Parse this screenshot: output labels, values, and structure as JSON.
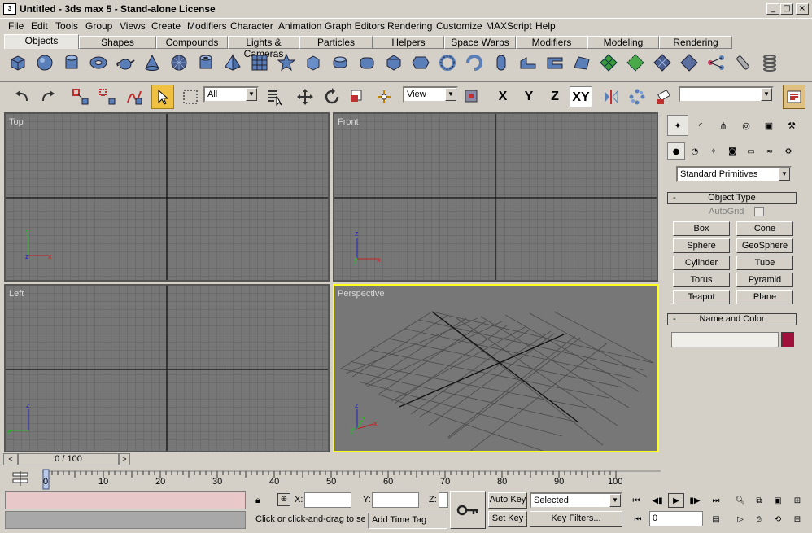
{
  "window": {
    "title": "Untitled - 3ds max 5 - Stand-alone License",
    "app_icon": "3ds-max-icon"
  },
  "menu": [
    "File",
    "Edit",
    "Tools",
    "Group",
    "Views",
    "Create",
    "Modifiers",
    "Character",
    "Animation",
    "Graph Editors",
    "Rendering",
    "Customize",
    "MAXScript",
    "Help"
  ],
  "tabs": [
    "Objects",
    "Shapes",
    "Compounds",
    "Lights & Cameras",
    "Particles",
    "Helpers",
    "Space Warps",
    "Modifiers",
    "Modeling",
    "Rendering"
  ],
  "active_tab": "Objects",
  "toolbar": {
    "selection_filter": "All",
    "reference_coord": "View",
    "axis_x": "X",
    "axis_y": "Y",
    "axis_z": "Z",
    "axis_xy": "XY",
    "named_selection": ""
  },
  "viewports": {
    "top": "Top",
    "front": "Front",
    "left": "Left",
    "perspective": "Perspective"
  },
  "command_panel": {
    "category": "Standard Primitives",
    "object_type_title": "Object Type",
    "autogrid_label": "AutoGrid",
    "buttons": [
      "Box",
      "Cone",
      "Sphere",
      "GeoSphere",
      "Cylinder",
      "Tube",
      "Torus",
      "Pyramid",
      "Teapot",
      "Plane"
    ],
    "name_color_title": "Name and Color",
    "name_value": "",
    "object_color": "#a0103a"
  },
  "timeline": {
    "slider_label": "0 / 100",
    "ticks": [
      "0",
      "10",
      "20",
      "30",
      "40",
      "50",
      "60",
      "70",
      "80",
      "90",
      "100"
    ]
  },
  "status": {
    "x_label": "X:",
    "y_label": "Y:",
    "z_label": "Z:",
    "x_value": "",
    "y_value": "",
    "z_value": "",
    "prompt": "Click or click-and-drag to se",
    "add_time_tag": "Add Time Tag",
    "auto_key": "Auto Key",
    "set_key": "Set Key",
    "key_mode": "Selected",
    "key_filters": "Key Filters...",
    "frame_value": "0"
  },
  "colors": {
    "viewport_bg": "#777777",
    "active_viewport_border": "#ffff20",
    "select_tool": "#f0c040",
    "status_pink": "#e8c8c8"
  }
}
